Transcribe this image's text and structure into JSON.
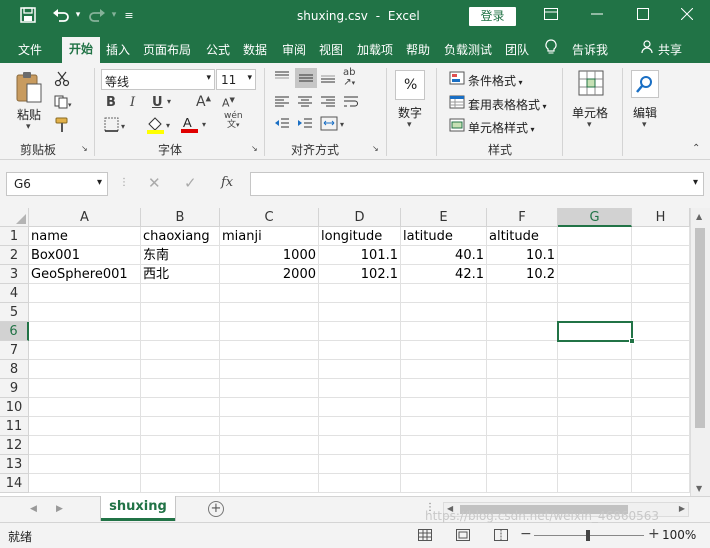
{
  "titlebar": {
    "filename": "shuxing.csv",
    "separator": "-",
    "app": "Excel",
    "login": "登录",
    "save_icon": "save-icon",
    "undo_icon": "undo-icon",
    "redo_icon": "redo-icon"
  },
  "menu": {
    "items": [
      "文件",
      "开始",
      "插入",
      "页面布局",
      "公式",
      "数据",
      "审阅",
      "视图",
      "加载项",
      "帮助",
      "负载测试",
      "团队"
    ],
    "tell_me": "告诉我",
    "share": "共享"
  },
  "ribbon": {
    "clipboard": {
      "paste": "粘贴",
      "label": "剪贴板"
    },
    "font": {
      "name": "等线",
      "size": "11",
      "label": "字体",
      "bold": "B",
      "italic": "I",
      "underline": "U",
      "grow": "A",
      "shrink": "A",
      "color_a": "A",
      "phonetic": "wén"
    },
    "alignment": {
      "label": "对齐方式"
    },
    "number": {
      "label": "数字",
      "symbol": "%"
    },
    "styles": {
      "conditional": "条件格式",
      "table": "套用表格格式",
      "cell": "单元格样式",
      "label": "样式"
    },
    "cells": {
      "label": "单元格"
    },
    "editing": {
      "label": "编辑"
    }
  },
  "formula_bar": {
    "name_box": "G6",
    "fx": "fx",
    "formula": ""
  },
  "grid": {
    "columns": [
      "A",
      "B",
      "C",
      "D",
      "E",
      "F",
      "G",
      "H"
    ],
    "rows": [
      "1",
      "2",
      "3",
      "4",
      "5",
      "6",
      "7",
      "8",
      "9",
      "10",
      "11",
      "12",
      "13",
      "14"
    ],
    "data": [
      [
        "name",
        "chaoxiang",
        "mianji",
        "longitude",
        "latitude",
        "altitude"
      ],
      [
        "Box001",
        "东南",
        "1000",
        "101.1",
        "40.1",
        "10.1"
      ],
      [
        "GeoSphere001",
        "西北",
        "2000",
        "102.1",
        "42.1",
        "10.2"
      ]
    ],
    "selected_cell": "G6"
  },
  "sheet": {
    "tab": "shuxing"
  },
  "status": {
    "ready": "就绪",
    "zoom": "100%",
    "watermark": "https://blog.csdn.net/weixin_46860563"
  },
  "colors": {
    "accent": "#217346"
  }
}
